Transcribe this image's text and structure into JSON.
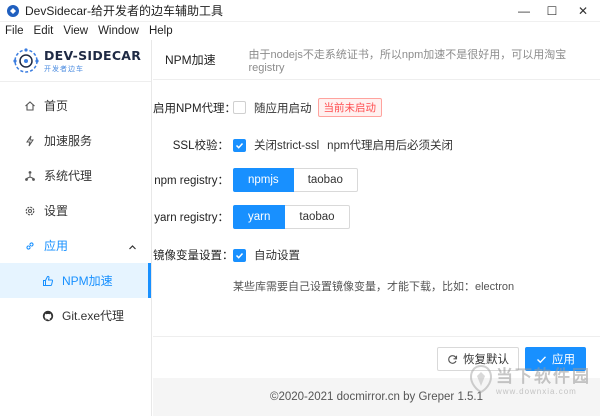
{
  "window": {
    "title": "DevSidecar-给开发者的边车辅助工具",
    "minimize": "—",
    "maximize": "☐",
    "close": "✕"
  },
  "menu": [
    "File",
    "Edit",
    "View",
    "Window",
    "Help"
  ],
  "logo": {
    "name": "DEV-SIDECAR",
    "sub": "开发者边车"
  },
  "sidebar": {
    "items": [
      {
        "label": "首页",
        "icon": "home-icon"
      },
      {
        "label": "加速服务",
        "icon": "lightning-icon"
      },
      {
        "label": "系统代理",
        "icon": "network-icon"
      },
      {
        "label": "设置",
        "icon": "gear-icon"
      },
      {
        "label": "应用",
        "icon": "link-icon"
      }
    ],
    "subitems": [
      {
        "label": "NPM加速",
        "icon": "thumbs-up-icon"
      },
      {
        "label": "Git.exe代理",
        "icon": "github-icon"
      }
    ]
  },
  "header": {
    "title": "NPM加速",
    "description": "由于nodejs不走系统证书，所以npm加速不是很好用，可以用淘宝registry"
  },
  "form": {
    "npm_proxy": {
      "label": "启用NPM代理：",
      "option": "随应用启动",
      "checked": false,
      "status": "当前未启动"
    },
    "ssl": {
      "label": "SSL校验：",
      "option": "关闭strict-ssl",
      "checked": true,
      "note": "npm代理启用后必须关闭"
    },
    "npm_registry": {
      "label": "npm registry：",
      "options": [
        "npmjs",
        "taobao"
      ],
      "selected": "npmjs"
    },
    "yarn_registry": {
      "label": "yarn registry：",
      "options": [
        "yarn",
        "taobao"
      ],
      "selected": "yarn"
    },
    "mirror_env": {
      "label": "镜像变量设置：",
      "option": "自动设置",
      "checked": true
    },
    "hint": "某些库需要自己设置镜像变量，才能下载，比如：electron"
  },
  "actions": {
    "reset": "恢复默认",
    "apply": "应用"
  },
  "footer": {
    "copyright": "©2020-2021 docmirror.cn by Greper 1.5.1"
  },
  "watermark": {
    "main": "当下软件园",
    "sub": "www.downxia.com"
  },
  "colors": {
    "accent": "#1890ff",
    "danger": "#ff4d4f",
    "footer_bg": "#f5f5f5"
  }
}
